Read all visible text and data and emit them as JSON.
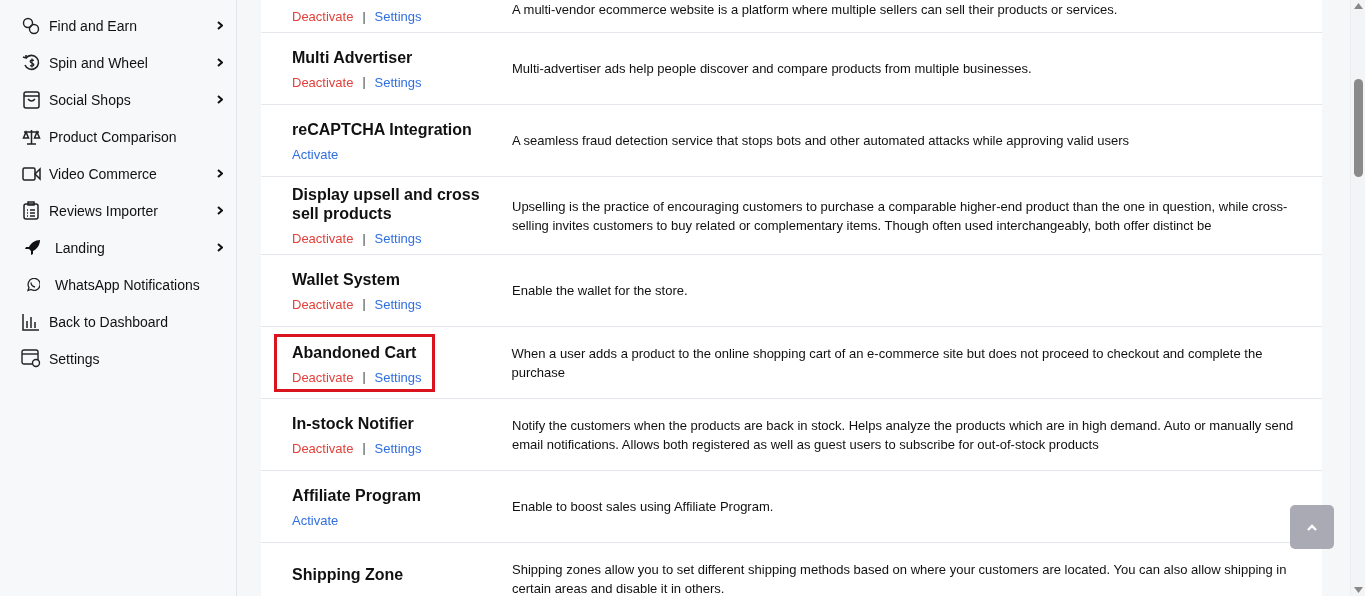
{
  "sidebar": {
    "items": [
      {
        "label": "Find and Earn",
        "has_submenu": true
      },
      {
        "label": "Spin and Wheel",
        "has_submenu": true
      },
      {
        "label": "Social Shops",
        "has_submenu": true
      },
      {
        "label": "Product Comparison",
        "has_submenu": false
      },
      {
        "label": "Video Commerce",
        "has_submenu": true
      },
      {
        "label": "Reviews Importer",
        "has_submenu": true
      },
      {
        "label": "Landing",
        "has_submenu": true
      },
      {
        "label": "WhatsApp Notifications",
        "has_submenu": false
      },
      {
        "label": "Back to Dashboard",
        "has_submenu": false
      },
      {
        "label": "Settings",
        "has_submenu": false
      }
    ]
  },
  "modules": [
    {
      "description": "A multi-vendor ecommerce website is a platform where multiple sellers can sell their products or services.",
      "highlighted": false,
      "actions": [
        {
          "label": "Deactivate",
          "kind": "deactivate"
        },
        {
          "label": "Settings",
          "kind": "settings"
        }
      ]
    },
    {
      "name": "Multi Advertiser",
      "description": "Multi-advertiser ads help people discover and compare products from multiple businesses.",
      "highlighted": false,
      "actions": [
        {
          "label": "Deactivate",
          "kind": "deactivate"
        },
        {
          "label": "Settings",
          "kind": "settings"
        }
      ]
    },
    {
      "name": "reCAPTCHA Integration",
      "description": "A seamless fraud detection service that stops bots and other automated attacks while approving valid users",
      "highlighted": false,
      "actions": [
        {
          "label": "Activate",
          "kind": "activate"
        }
      ]
    },
    {
      "name": "Display upsell and cross sell products",
      "description": "Upselling is the practice of encouraging customers to purchase a comparable higher-end product than the one in question, while cross-selling invites customers to buy related or complementary items. Though often used interchangeably, both offer distinct be",
      "highlighted": false,
      "actions": [
        {
          "label": "Deactivate",
          "kind": "deactivate"
        },
        {
          "label": "Settings",
          "kind": "settings"
        }
      ]
    },
    {
      "name": "Wallet System",
      "description": "Enable the wallet for the store.",
      "highlighted": false,
      "actions": [
        {
          "label": "Deactivate",
          "kind": "deactivate"
        },
        {
          "label": "Settings",
          "kind": "settings"
        }
      ]
    },
    {
      "name": "Abandoned Cart",
      "description": "When a user adds a product to the online shopping cart of an e-commerce site but does not proceed to checkout and complete the purchase",
      "highlighted": true,
      "actions": [
        {
          "label": "Deactivate",
          "kind": "deactivate"
        },
        {
          "label": "Settings",
          "kind": "settings"
        }
      ]
    },
    {
      "name": "In-stock Notifier",
      "description": "Notify the customers when the products are back in stock. Helps analyze the products which are in high demand. Auto or manually send email notifications. Allows both registered as well as guest users to subscribe for out-of-stock products",
      "highlighted": false,
      "actions": [
        {
          "label": "Deactivate",
          "kind": "deactivate"
        },
        {
          "label": "Settings",
          "kind": "settings"
        }
      ]
    },
    {
      "name": "Affiliate Program",
      "description": "Enable to boost sales using Affiliate Program.",
      "highlighted": false,
      "actions": [
        {
          "label": "Activate",
          "kind": "activate"
        }
      ]
    },
    {
      "name": "Shipping Zone",
      "description": "Shipping zones allow you to set different shipping methods based on where your customers are located. You can also allow shipping in certain areas and disable it in others.",
      "highlighted": false
    }
  ],
  "separator": "|"
}
